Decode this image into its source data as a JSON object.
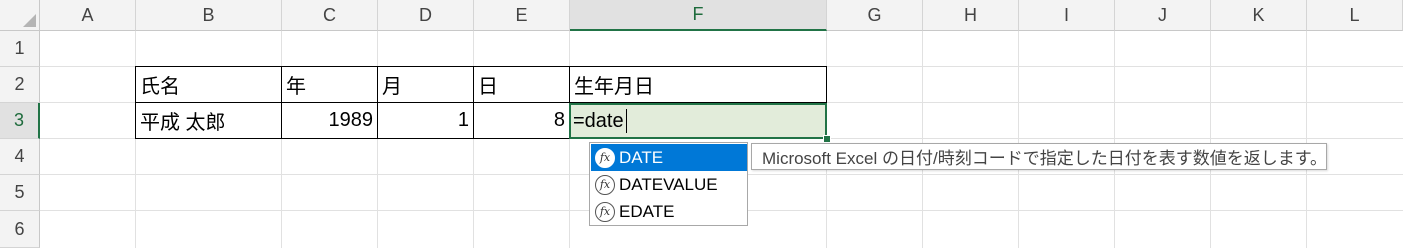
{
  "columns": [
    "A",
    "B",
    "C",
    "D",
    "E",
    "F",
    "G",
    "H",
    "I",
    "J",
    "K",
    "L"
  ],
  "rows": [
    "1",
    "2",
    "3",
    "4",
    "5",
    "6"
  ],
  "headers": {
    "name": "氏名",
    "year": "年",
    "month": "月",
    "day": "日",
    "birthdate": "生年月日"
  },
  "record": {
    "name": "平成 太郎",
    "year": "1989",
    "month": "1",
    "day": "8"
  },
  "active_cell": {
    "column": "F",
    "row": "3",
    "formula": "=date"
  },
  "autocomplete": {
    "items": [
      "DATE",
      "DATEVALUE",
      "EDATE"
    ],
    "selected_index": 0,
    "fx_glyph": "fx",
    "tooltip": "Microsoft Excel の日付/時刻コードで指定した日付を表す数値を返します。"
  },
  "colors": {
    "selection_green": "#217346",
    "active_cell_fill": "#e2ecda",
    "autocomplete_highlight": "#0078d7"
  }
}
